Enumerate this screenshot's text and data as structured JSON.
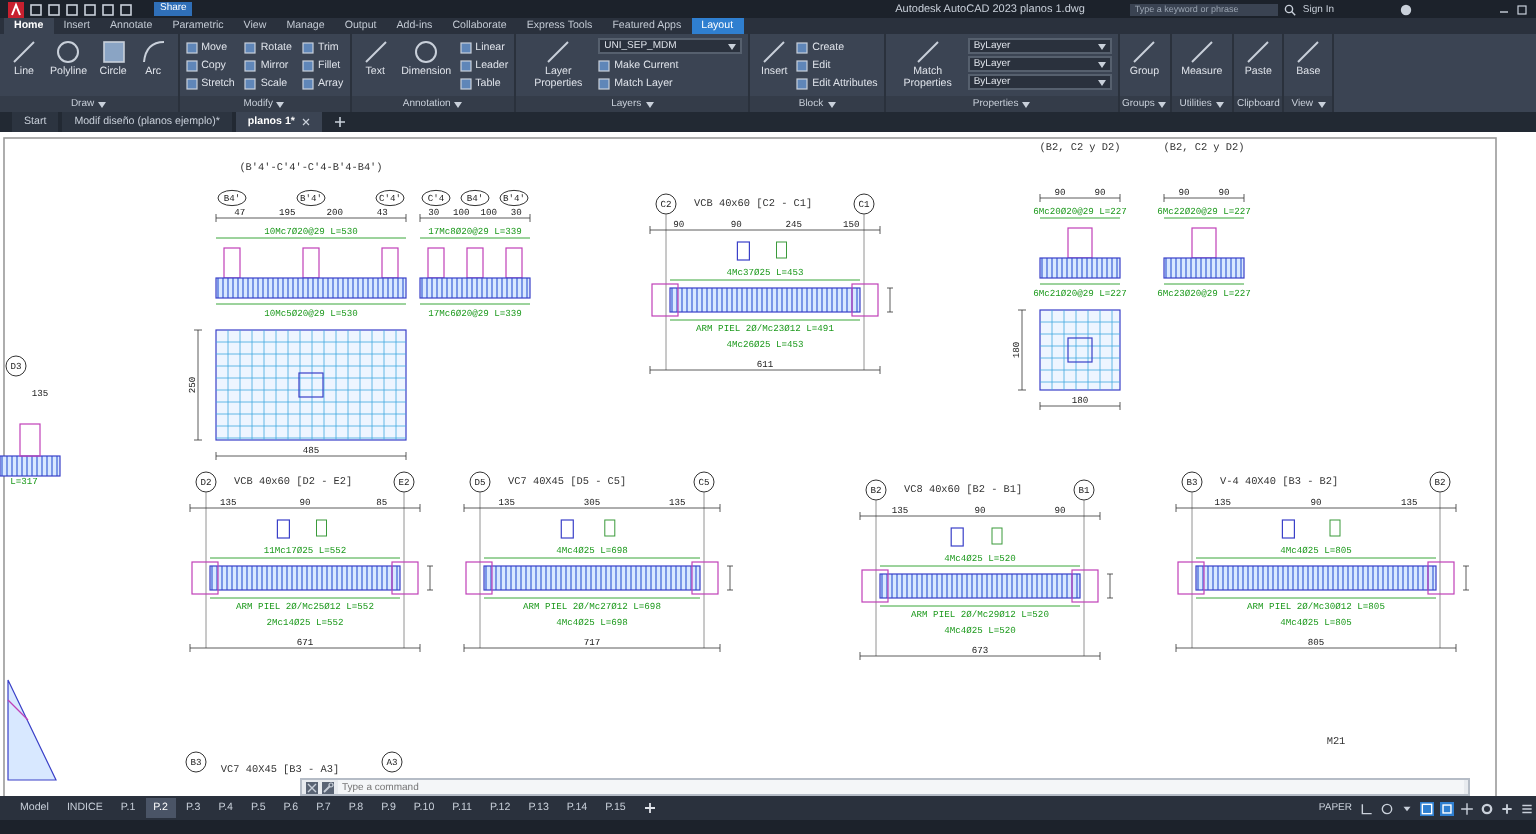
{
  "title_bar": {
    "share": "Share",
    "title": "Autodesk AutoCAD 2023  planos 1.dwg",
    "search": {
      "placeholder": "Type a keyword or phrase"
    },
    "sign_in": "Sign In"
  },
  "ribbon_tabs": [
    {
      "label": "Home",
      "selected": true,
      "highlighted": false
    },
    {
      "label": "Insert",
      "selected": false,
      "highlighted": false
    },
    {
      "label": "Annotate",
      "selected": false,
      "highlighted": false
    },
    {
      "label": "Parametric",
      "selected": false,
      "highlighted": false
    },
    {
      "label": "View",
      "selected": false,
      "highlighted": false
    },
    {
      "label": "Manage",
      "selected": false,
      "highlighted": false
    },
    {
      "label": "Output",
      "selected": false,
      "highlighted": false
    },
    {
      "label": "Add-ins",
      "selected": false,
      "highlighted": false
    },
    {
      "label": "Collaborate",
      "selected": false,
      "highlighted": false
    },
    {
      "label": "Express Tools",
      "selected": false,
      "highlighted": false
    },
    {
      "label": "Featured Apps",
      "selected": false,
      "highlighted": false
    },
    {
      "label": "Layout",
      "selected": false,
      "highlighted": true
    }
  ],
  "panels": [
    {
      "title": "Draw",
      "menu": true,
      "large": [
        "Line",
        "Polyline",
        "Circle",
        "Arc"
      ]
    },
    {
      "title": "Modify",
      "menu": true,
      "small": [
        "Move",
        "Copy",
        "Stretch",
        "Rotate",
        "Mirror",
        "Scale",
        "Trim",
        "Fillet",
        "Array"
      ]
    },
    {
      "title": "Annotation",
      "menu": true,
      "large": [
        "Text",
        "Dimension"
      ],
      "small": [
        "Linear",
        "Leader",
        "Table"
      ]
    },
    {
      "title": "Layers",
      "menu": true,
      "large": [
        "Layer Properties"
      ],
      "dropdowns": [
        "UNI_SEP_MDM"
      ],
      "small": [
        "Make Current",
        "Match Layer"
      ]
    },
    {
      "title": "Block",
      "menu": true,
      "large": [
        "Insert"
      ],
      "small": [
        "Create",
        "Edit",
        "Edit Attributes"
      ]
    },
    {
      "title": "Properties",
      "menu": true,
      "large": [
        "Match Properties"
      ],
      "dropdowns": [
        "ByLayer",
        "ByLayer",
        "ByLayer"
      ]
    },
    {
      "title": "Groups",
      "menu": true,
      "large": [
        "Group"
      ]
    },
    {
      "title": "Utilities",
      "menu": true,
      "large": [
        "Measure"
      ]
    },
    {
      "title": "Clipboard",
      "menu": false,
      "large": [
        "Paste"
      ]
    },
    {
      "title": "View",
      "menu": true,
      "large": [
        "Base"
      ]
    }
  ],
  "file_tabs": [
    {
      "label": "Start",
      "selected": false
    },
    {
      "label": "Modif diseño (planos ejemplo)*",
      "selected": false
    },
    {
      "label": "planos 1*",
      "selected": true
    }
  ],
  "drawing": {
    "details": [
      {
        "kind": "footing-with-plan",
        "title": "(B'4'-C'4'-C'4-B'4-B4')",
        "bubbles": [
          "B4'",
          "B'4'",
          "C'4'"
        ],
        "dims": [
          "47",
          "195",
          "200",
          "43"
        ],
        "notes": [
          "10Mc7Ø20@29  L=530",
          "10Mc5Ø20@29  L=530"
        ],
        "span": "485",
        "side": "250"
      },
      {
        "kind": "footing",
        "bubbles": [
          "C'4",
          "B4'",
          "B'4'"
        ],
        "dims": [
          "30",
          "100",
          "100",
          "30"
        ],
        "notes": [
          "17Mc8Ø20@29  L=339",
          "17Mc6Ø20@29  L=339"
        ]
      },
      {
        "kind": "beam",
        "title": "VCB 40x60 [C2 - C1]",
        "bubbles": [
          "C2",
          "C1"
        ],
        "dims": [
          "90",
          "90",
          "245",
          "150"
        ],
        "notes": [
          "4Mc37Ø25  L=453",
          "ARM PIEL 2Ø/Mc23Ø12  L=491",
          "4Mc26Ø25  L=453"
        ],
        "span": "611"
      },
      {
        "kind": "footing-with-plan",
        "title": "(B2, C2 y D2)",
        "dims": [
          "90",
          "90"
        ],
        "notes": [
          "6Mc20Ø20@29  L=227",
          "6Mc21Ø20@29  L=227"
        ],
        "span": "180",
        "side": "180"
      },
      {
        "kind": "footing",
        "title": "(B2, C2 y D2)",
        "dims": [
          "90",
          "90"
        ],
        "notes": [
          "6Mc22Ø20@29  L=227",
          "6Mc23Ø20@29  L=227"
        ]
      },
      {
        "kind": "beam",
        "title": "VCB 40x60 [D2 - E2]",
        "bubbles": [
          "D2",
          "E2"
        ],
        "dims": [
          "135",
          "90",
          "85"
        ],
        "notes": [
          "11Mc17Ø25  L=552",
          "ARM PIEL 2Ø/Mc25Ø12  L=552",
          "2Mc14Ø25  L=552"
        ],
        "span": "671"
      },
      {
        "kind": "beam",
        "title": "VC7 40X45 [D5 - C5]",
        "bubbles": [
          "D5",
          "C5"
        ],
        "dims": [
          "135",
          "305",
          "135"
        ],
        "notes": [
          "4Mc4Ø25  L=698",
          "ARM PIEL 2Ø/Mc27Ø12  L=698",
          "4Mc4Ø25  L=698"
        ],
        "span": "717"
      },
      {
        "kind": "beam",
        "title": "VC8 40x60 [B2 - B1]",
        "bubbles": [
          "B2",
          "B1"
        ],
        "dims": [
          "135",
          "90",
          "90"
        ],
        "notes": [
          "4Mc4Ø25  L=520",
          "ARM PIEL 2Ø/Mc29Ø12  L=520",
          "4Mc4Ø25  L=520"
        ],
        "span": "673"
      },
      {
        "kind": "beam",
        "title": "V-4 40X40 [B3 - B2]",
        "bubbles": [
          "B3",
          "B2"
        ],
        "dims": [
          "135",
          "90",
          "135"
        ],
        "notes": [
          "4Mc4Ø25  L=805",
          "ARM PIEL 2Ø/Mc30Ø12  L=805",
          "4Mc4Ø25  L=805"
        ],
        "span": "805"
      }
    ],
    "labels": [
      {
        "kind": "bubble",
        "text": "D3"
      },
      {
        "kind": "dimension",
        "text": "135"
      },
      {
        "kind": "note",
        "text": "L=317"
      },
      {
        "kind": "title",
        "text": "VC7 40X45 [B3 - A3]"
      },
      {
        "kind": "title",
        "text": "M21"
      },
      {
        "kind": "bubble",
        "text": "B3"
      },
      {
        "kind": "bubble",
        "text": "A3"
      }
    ]
  },
  "command_line": {
    "placeholder": "Type a command"
  },
  "layout_tabs": [
    {
      "label": "Model",
      "selected": false
    },
    {
      "label": "INDICE",
      "selected": false
    },
    {
      "label": "P.1",
      "selected": false
    },
    {
      "label": "P.2",
      "selected": true
    },
    {
      "label": "P.3",
      "selected": false
    },
    {
      "label": "P.4",
      "selected": false
    },
    {
      "label": "P.5",
      "selected": false
    },
    {
      "label": "P.6",
      "selected": false
    },
    {
      "label": "P.7",
      "selected": false
    },
    {
      "label": "P.8",
      "selected": false
    },
    {
      "label": "P.9",
      "selected": false
    },
    {
      "label": "P.10",
      "selected": false
    },
    {
      "label": "P.11",
      "selected": false
    },
    {
      "label": "P.12",
      "selected": false
    },
    {
      "label": "P.13",
      "selected": false
    },
    {
      "label": "P.14",
      "selected": false
    },
    {
      "label": "P.15",
      "selected": false
    }
  ],
  "status_bar": {
    "space": "PAPER"
  }
}
